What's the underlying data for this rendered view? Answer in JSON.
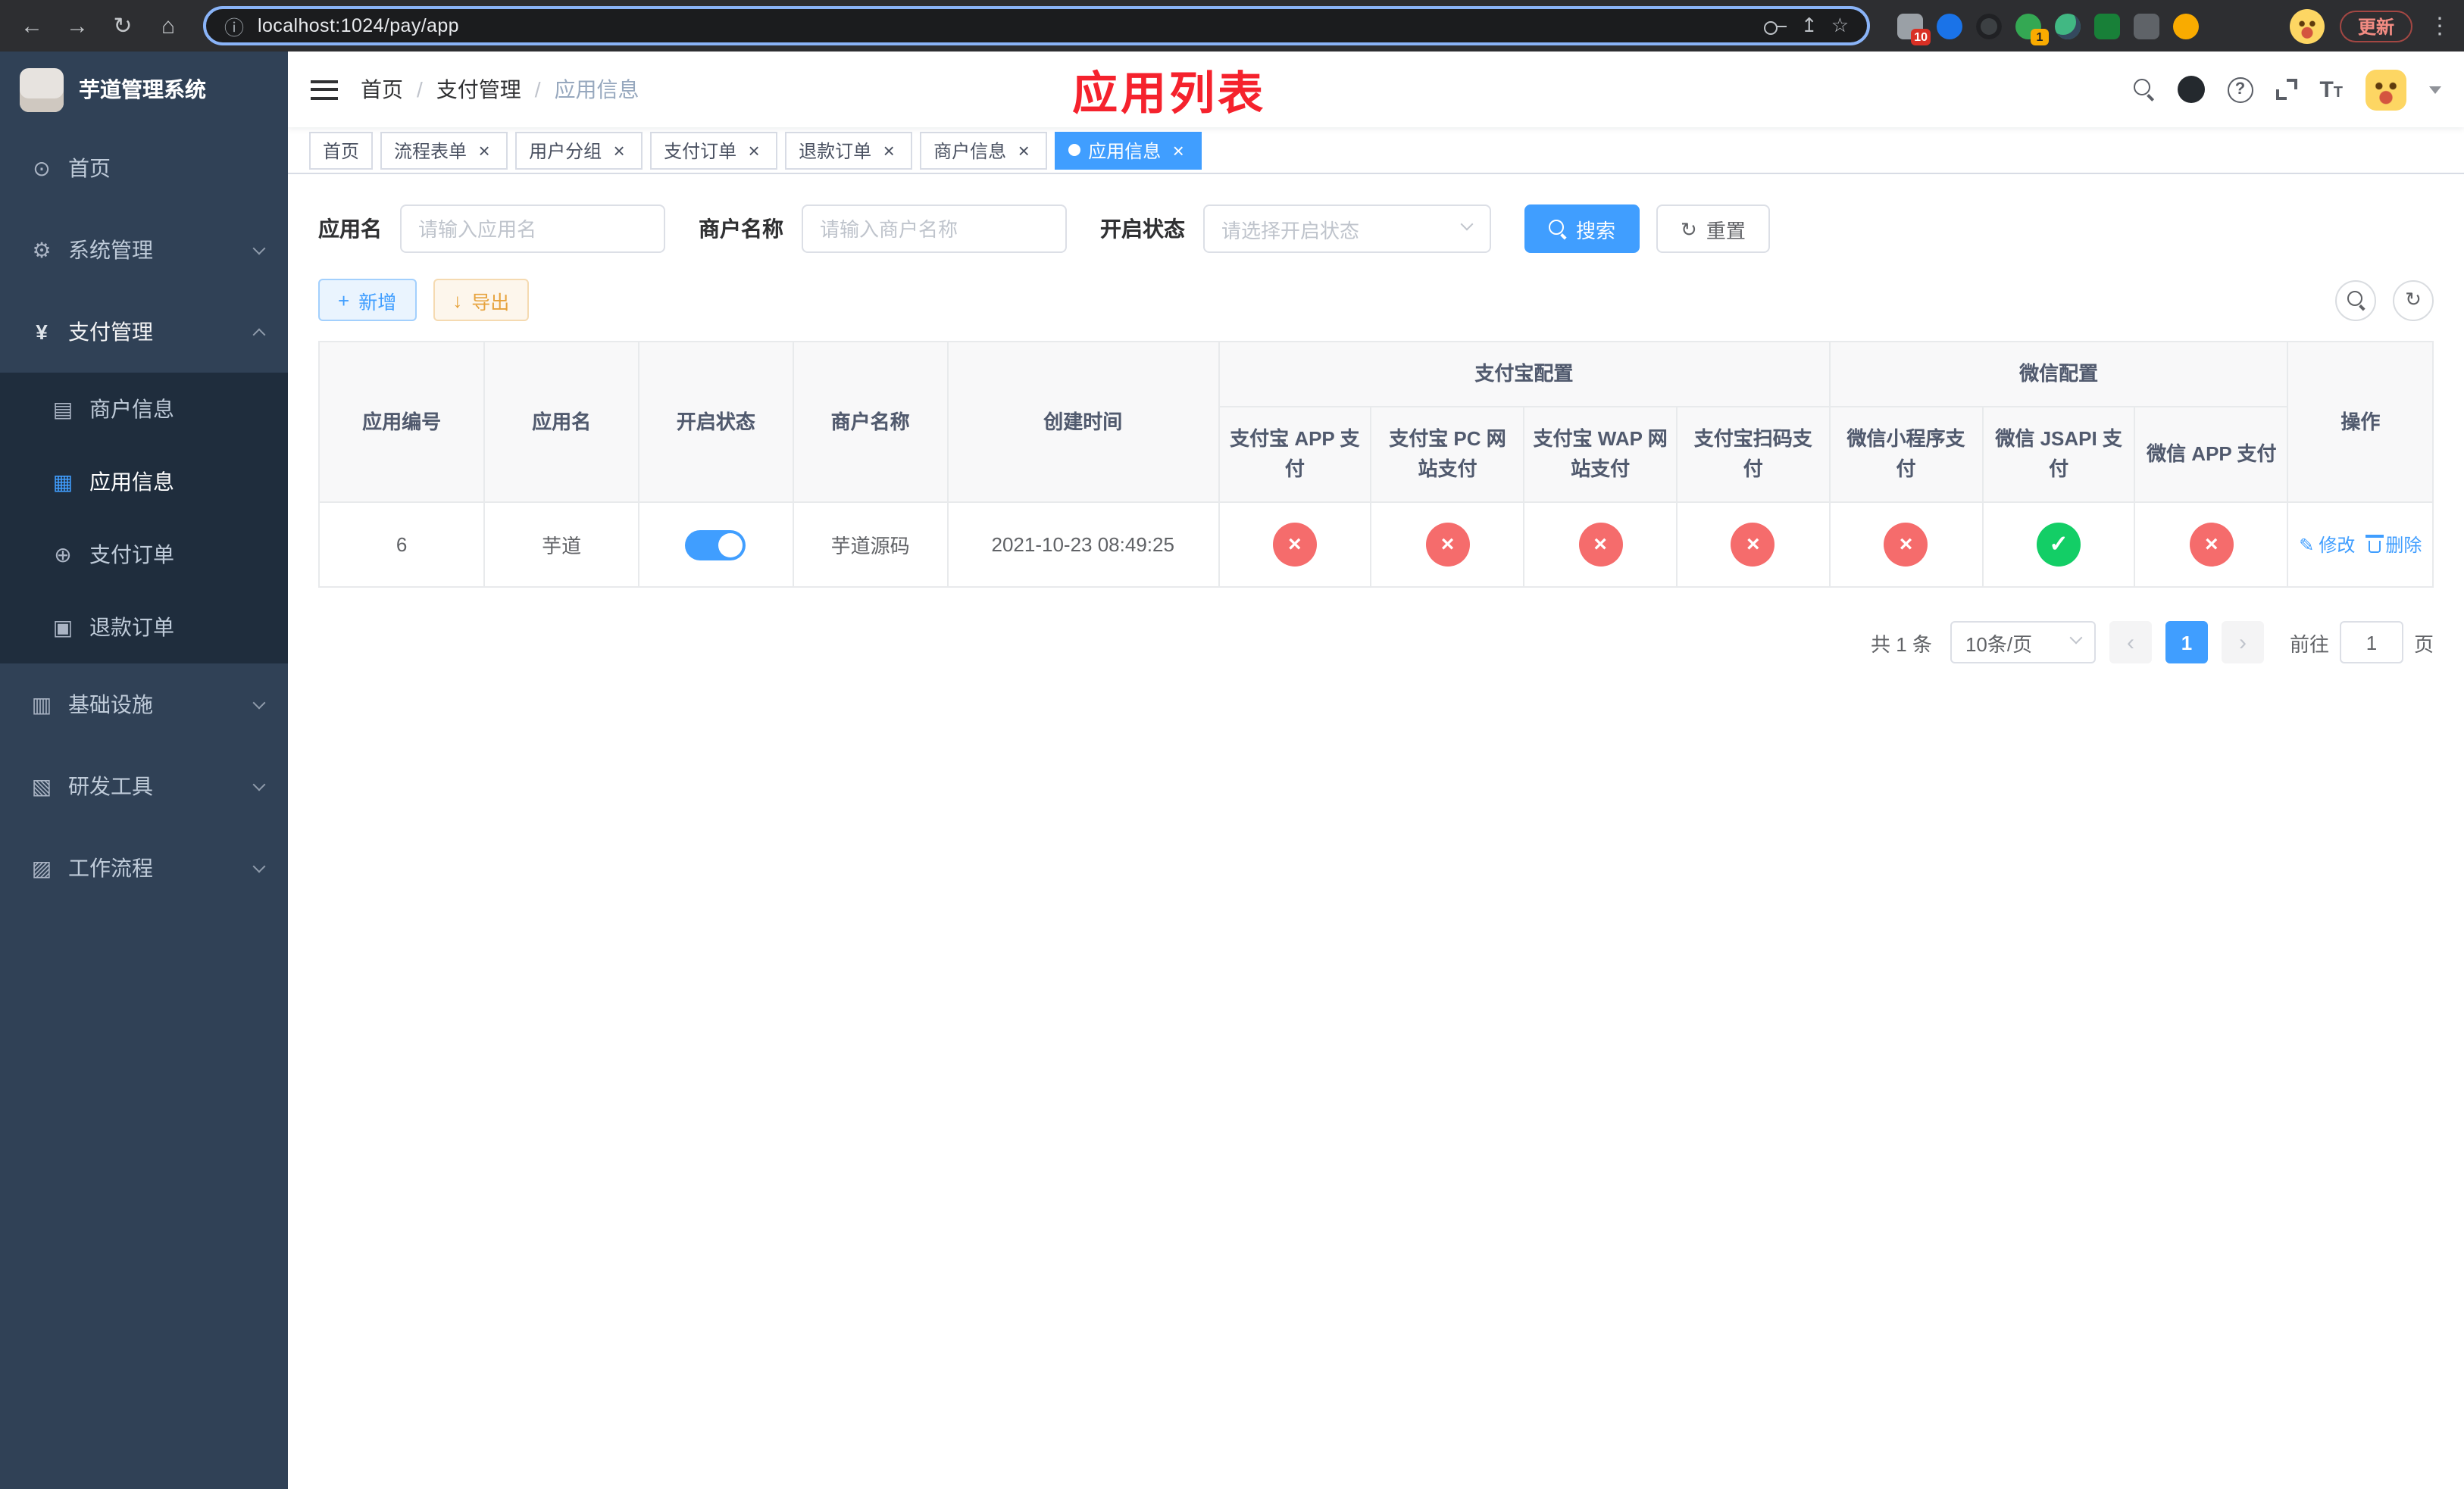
{
  "browser": {
    "url": "localhost:1024/pay/app",
    "update_label": "更新",
    "extension_badge_first": "10",
    "extension_badge_second": "1"
  },
  "sidebar": {
    "logo_title": "芋道管理系统",
    "menu": {
      "home": "首页",
      "system": "系统管理",
      "payment": "支付管理",
      "merchant_info": "商户信息",
      "app_info": "应用信息",
      "pay_order": "支付订单",
      "refund_order": "退款订单",
      "infrastructure": "基础设施",
      "dev_tools": "研发工具",
      "workflow": "工作流程"
    }
  },
  "navbar": {
    "breadcrumb": [
      "首页",
      "支付管理",
      "应用信息"
    ],
    "separator": "/",
    "page_title": "应用列表"
  },
  "tabs": [
    {
      "label": "首页"
    },
    {
      "label": "流程表单"
    },
    {
      "label": "用户分组"
    },
    {
      "label": "支付订单"
    },
    {
      "label": "退款订单"
    },
    {
      "label": "商户信息"
    },
    {
      "label": "应用信息"
    }
  ],
  "filters": {
    "app_name": {
      "label": "应用名",
      "placeholder": "请输入应用名",
      "value": ""
    },
    "merchant_name": {
      "label": "商户名称",
      "placeholder": "请输入商户名称",
      "value": ""
    },
    "status": {
      "label": "开启状态",
      "placeholder": "请选择开启状态"
    },
    "search_button": "搜索",
    "reset_button": "重置"
  },
  "toolbar": {
    "add_button": "新增",
    "export_button": "导出"
  },
  "table": {
    "columns": {
      "app_id": "应用编号",
      "app_name": "应用名",
      "status": "开启状态",
      "merchant_name": "商户名称",
      "create_time": "创建时间",
      "alipay_group": "支付宝配置",
      "wechat_group": "微信配置",
      "alipay_app": "支付宝 APP 支付",
      "alipay_pc": "支付宝 PC 网站支付",
      "alipay_wap": "支付宝 WAP 网站支付",
      "alipay_qr": "支付宝扫码支付",
      "wx_lite": "微信小程序支付",
      "wx_jsapi": "微信 JSAPI 支付",
      "wx_app": "微信 APP 支付",
      "actions": "操作"
    },
    "rows": [
      {
        "app_id": "6",
        "app_name": "芋道",
        "status_on": true,
        "merchant_name": "芋道源码",
        "create_time": "2021-10-23 08:49:25",
        "configs": {
          "alipay_app": false,
          "alipay_pc": false,
          "alipay_wap": false,
          "alipay_qr": false,
          "wx_lite": false,
          "wx_jsapi": true,
          "wx_app": false
        },
        "edit_label": "修改",
        "delete_label": "删除"
      }
    ]
  },
  "pagination": {
    "total": "共 1 条",
    "page_size": "10条/页",
    "current_page": "1",
    "goto_label": "前往",
    "goto_value": "1",
    "page_unit": "页"
  },
  "icons": {
    "back": "←",
    "forward": "→",
    "reload": "↻",
    "home": "⌂",
    "info": "ⓘ",
    "share": "↥",
    "star": "☆",
    "kebab": "⋮",
    "question": "?",
    "plus": "+",
    "download": "↓",
    "check": "✓",
    "cross": "×",
    "close": "×",
    "edit": "✎",
    "prev": "‹",
    "next": "›",
    "refresh": "↻",
    "letter_t": "T",
    "yuan": "¥",
    "dashboard": "⊙",
    "gear": "⚙",
    "merchant": "▤",
    "grid": "▦",
    "order": "⊕",
    "refund": "▣",
    "infra": "▥",
    "tools": "▧",
    "flow": "▨"
  },
  "colors": {
    "primary": "#409eff",
    "danger": "#f56c6c",
    "success": "#13ce66",
    "warning": "#e6a23c",
    "title_red": "#f5222d"
  }
}
